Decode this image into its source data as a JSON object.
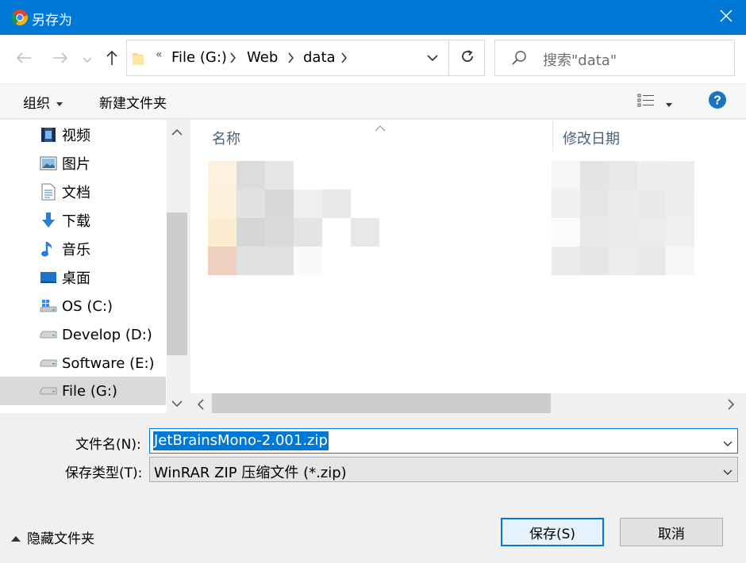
{
  "window": {
    "title": "另存为",
    "app_icon": "chrome-icon",
    "close_icon": "close-icon"
  },
  "nav": {
    "back_icon": "arrow-left-icon",
    "forward_icon": "arrow-right-icon",
    "recent_icon": "chevron-down-icon",
    "up_icon": "arrow-up-icon",
    "address_overflow": "«",
    "breadcrumbs": [
      "File (G:)",
      "Web",
      "data"
    ],
    "refresh_icon": "refresh-icon",
    "search_placeholder": "搜索\"data\""
  },
  "toolbar": {
    "organize_label": "组织",
    "new_folder_label": "新建文件夹",
    "view_icon": "details-view-icon",
    "help_label": "?"
  },
  "sidebar": {
    "items": [
      {
        "label": "视频",
        "icon": "video-icon"
      },
      {
        "label": "图片",
        "icon": "pictures-icon"
      },
      {
        "label": "文档",
        "icon": "documents-icon"
      },
      {
        "label": "下载",
        "icon": "download-icon"
      },
      {
        "label": "音乐",
        "icon": "music-icon"
      },
      {
        "label": "桌面",
        "icon": "desktop-icon"
      },
      {
        "label": "OS (C:)",
        "icon": "windows-drive-icon"
      },
      {
        "label": "Develop (D:)",
        "icon": "drive-icon"
      },
      {
        "label": "Software (E:)",
        "icon": "drive-icon"
      },
      {
        "label": "File (G:)",
        "icon": "drive-icon",
        "selected": true
      }
    ]
  },
  "filelist": {
    "col_name": "名称",
    "col_modified": "修改日期"
  },
  "form": {
    "filename_label": "文件名(N):",
    "filename_value": "JetBrainsMono-2.001.zip",
    "filetype_label": "保存类型(T):",
    "filetype_value": "WinRAR ZIP 压缩文件 (*.zip)"
  },
  "footer": {
    "hide_folders_label": "隐藏文件夹",
    "save_label": "保存(S)",
    "cancel_label": "取消"
  },
  "colors": {
    "accent": "#0078d7",
    "titlebar": "#0078d7",
    "selected_bg": "#d9d9d9"
  }
}
